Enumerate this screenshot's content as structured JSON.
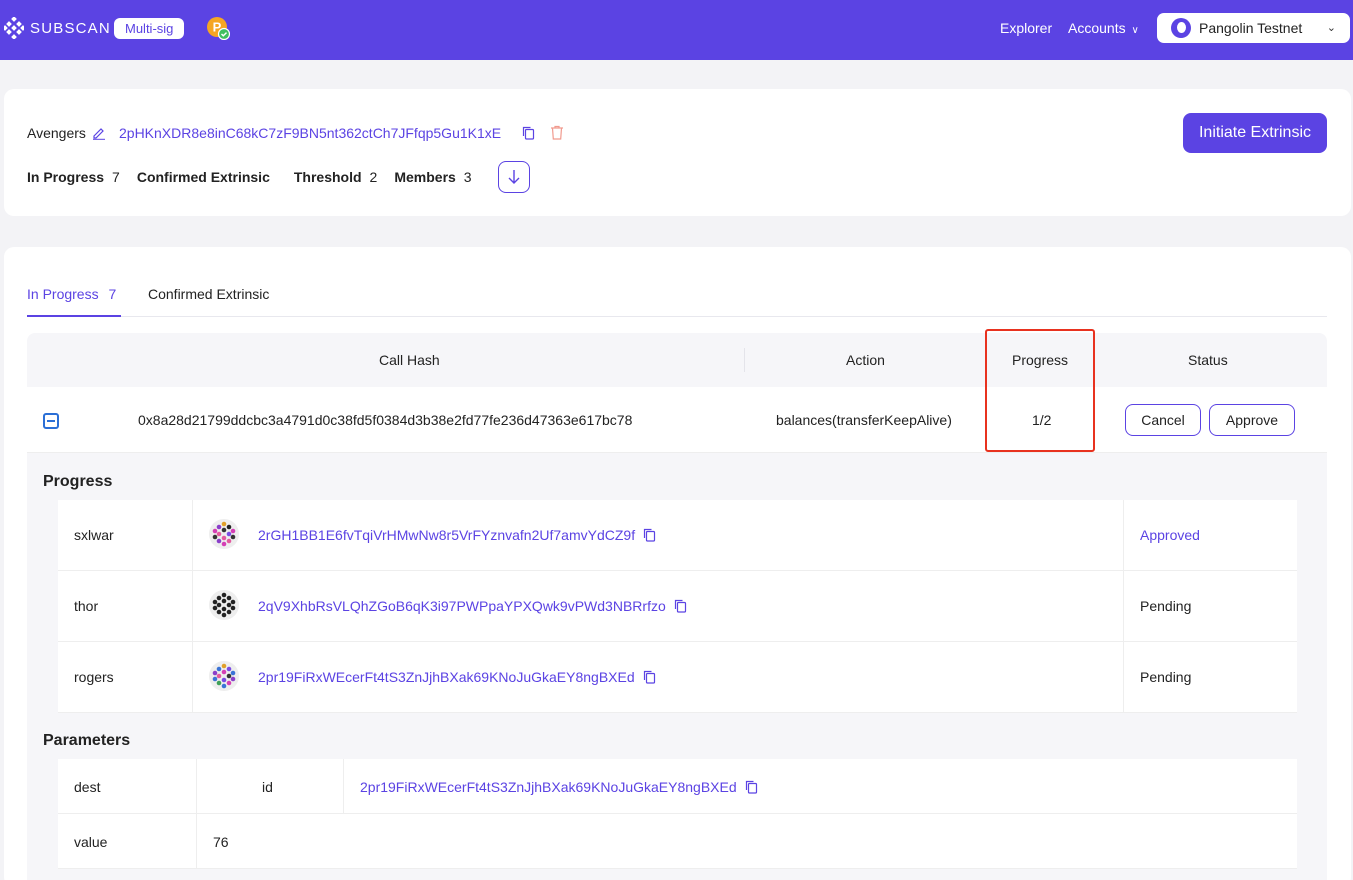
{
  "header": {
    "logo_text": "SUBSCAN",
    "badge": "Multi-sig",
    "nav_explorer": "Explorer",
    "nav_accounts": "Accounts",
    "network": "Pangolin Testnet"
  },
  "account": {
    "name": "Avengers",
    "address": "2pHKnXDR8e8inC68kC7zF9BN5nt362ctCh7JFfqp5Gu1K1xE",
    "stats": {
      "in_progress_label": "In Progress",
      "in_progress_count": "7",
      "confirmed_label": "Confirmed Extrinsic",
      "threshold_label": "Threshold",
      "threshold_value": "2",
      "members_label": "Members",
      "members_value": "3"
    },
    "initiate_label": "Initiate Extrinsic"
  },
  "tabs": {
    "in_progress_label": "In Progress",
    "in_progress_count": "7",
    "confirmed_label": "Confirmed Extrinsic"
  },
  "table": {
    "headers": {
      "call_hash": "Call Hash",
      "action": "Action",
      "progress": "Progress",
      "status": "Status"
    },
    "row": {
      "call_hash": "0x8a28d21799ddcbc3a4791d0c38fd5f0384d3b38e2fd77fe236d47363e617bc78",
      "action": "balances(transferKeepAlive)",
      "progress": "1/2",
      "cancel_label": "Cancel",
      "approve_label": "Approve"
    }
  },
  "progress_section": {
    "title": "Progress",
    "members": [
      {
        "name": "sxlwar",
        "address": "2rGH1BB1E6fvTqiVrHMwNw8r5VrFYznvafn2Uf7amvYdCZ9f",
        "status": "Approved",
        "status_color": "#5b43e3"
      },
      {
        "name": "thor",
        "address": "2qV9XhbRsVLQhZGoB6qK3i97PWPpaYPXQwk9vPWd3NBRrfzo",
        "status": "Pending",
        "status_color": "#222222"
      },
      {
        "name": "rogers",
        "address": "2pr19FiRxWEcerFt4tS3ZnJjhBXak69KNoJuGkaEY8ngBXEd",
        "status": "Pending",
        "status_color": "#222222"
      }
    ]
  },
  "parameters_section": {
    "title": "Parameters",
    "rows": [
      {
        "name": "dest",
        "key": "id",
        "value": "2pr19FiRxWEcerFt4tS3ZnJjhBXak69KNoJuGkaEY8ngBXEd"
      },
      {
        "name": "value",
        "key": "",
        "value": "76"
      }
    ]
  },
  "colors": {
    "accent": "#5b43e3",
    "highlight": "#e8321f"
  }
}
